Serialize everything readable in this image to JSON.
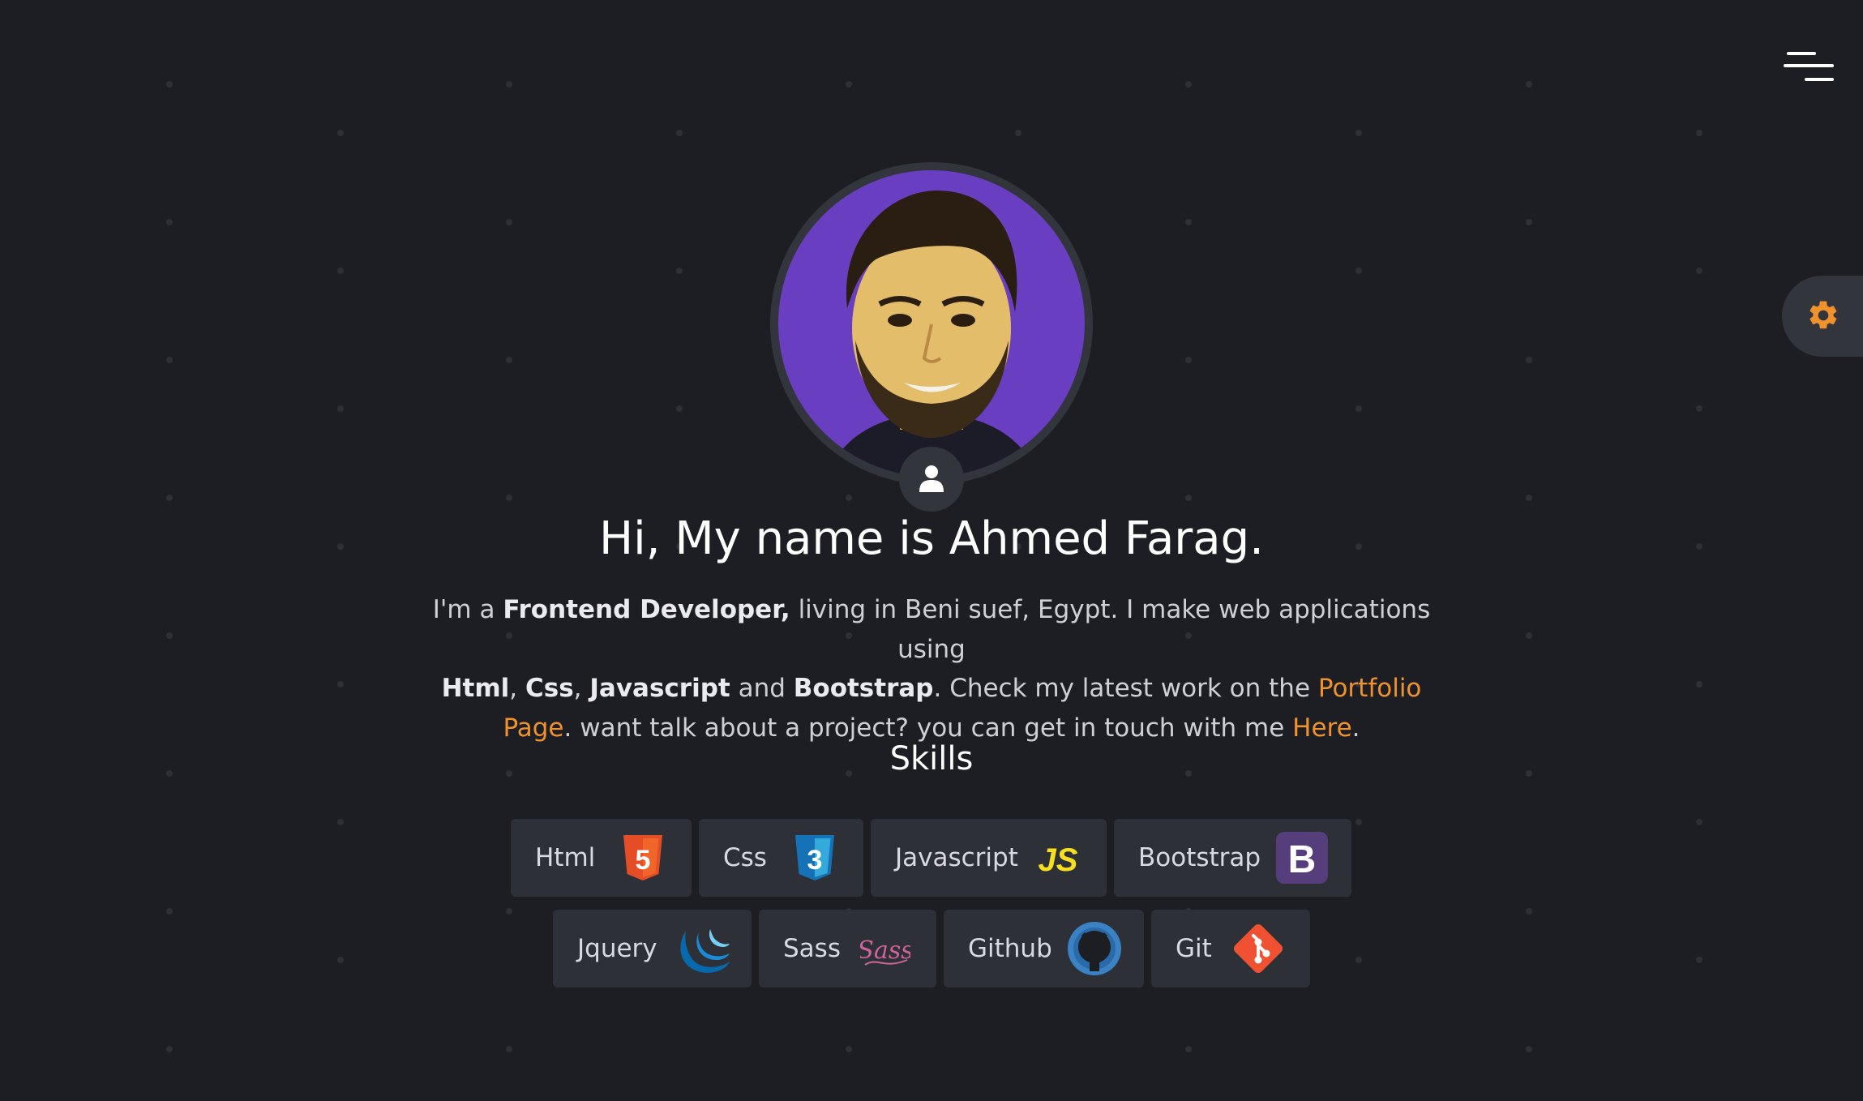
{
  "header": {
    "menu_icon": "hamburger-menu-icon",
    "settings_icon": "gear-icon"
  },
  "profile": {
    "avatar_alt": "profile-photo",
    "badge_icon": "user-icon",
    "title": "Hi, My name is Ahmed Farag."
  },
  "bio": {
    "p1": "I'm a ",
    "role": "Frontend Developer,",
    "p2": " living in Beni suef, Egypt. I make web applications using ",
    "tech1": "Html",
    "sep1": ", ",
    "tech2": "Css",
    "sep2": ", ",
    "tech3": "Javascript",
    "p3": " and ",
    "tech4": "Bootstrap",
    "p4": ". Check my latest work on the ",
    "portfolio_link": "Portfolio Page",
    "p5": ". want talk about a project? you can get in touch with me ",
    "contact_link": "Here",
    "p6": "."
  },
  "skills": {
    "title": "Skills",
    "items": [
      {
        "label": "Html",
        "icon": "html5-icon"
      },
      {
        "label": "Css",
        "icon": "css3-icon"
      },
      {
        "label": "Javascript",
        "icon": "javascript-icon"
      },
      {
        "label": "Bootstrap",
        "icon": "bootstrap-icon"
      },
      {
        "label": "Jquery",
        "icon": "jquery-icon"
      },
      {
        "label": "Sass",
        "icon": "sass-icon"
      },
      {
        "label": "Github",
        "icon": "github-icon"
      },
      {
        "label": "Git",
        "icon": "git-icon"
      }
    ]
  },
  "colors": {
    "background": "#1d1e23",
    "accent": "#f0922c",
    "card": "#2e3038",
    "avatar_bg": "#6a3ec0"
  }
}
